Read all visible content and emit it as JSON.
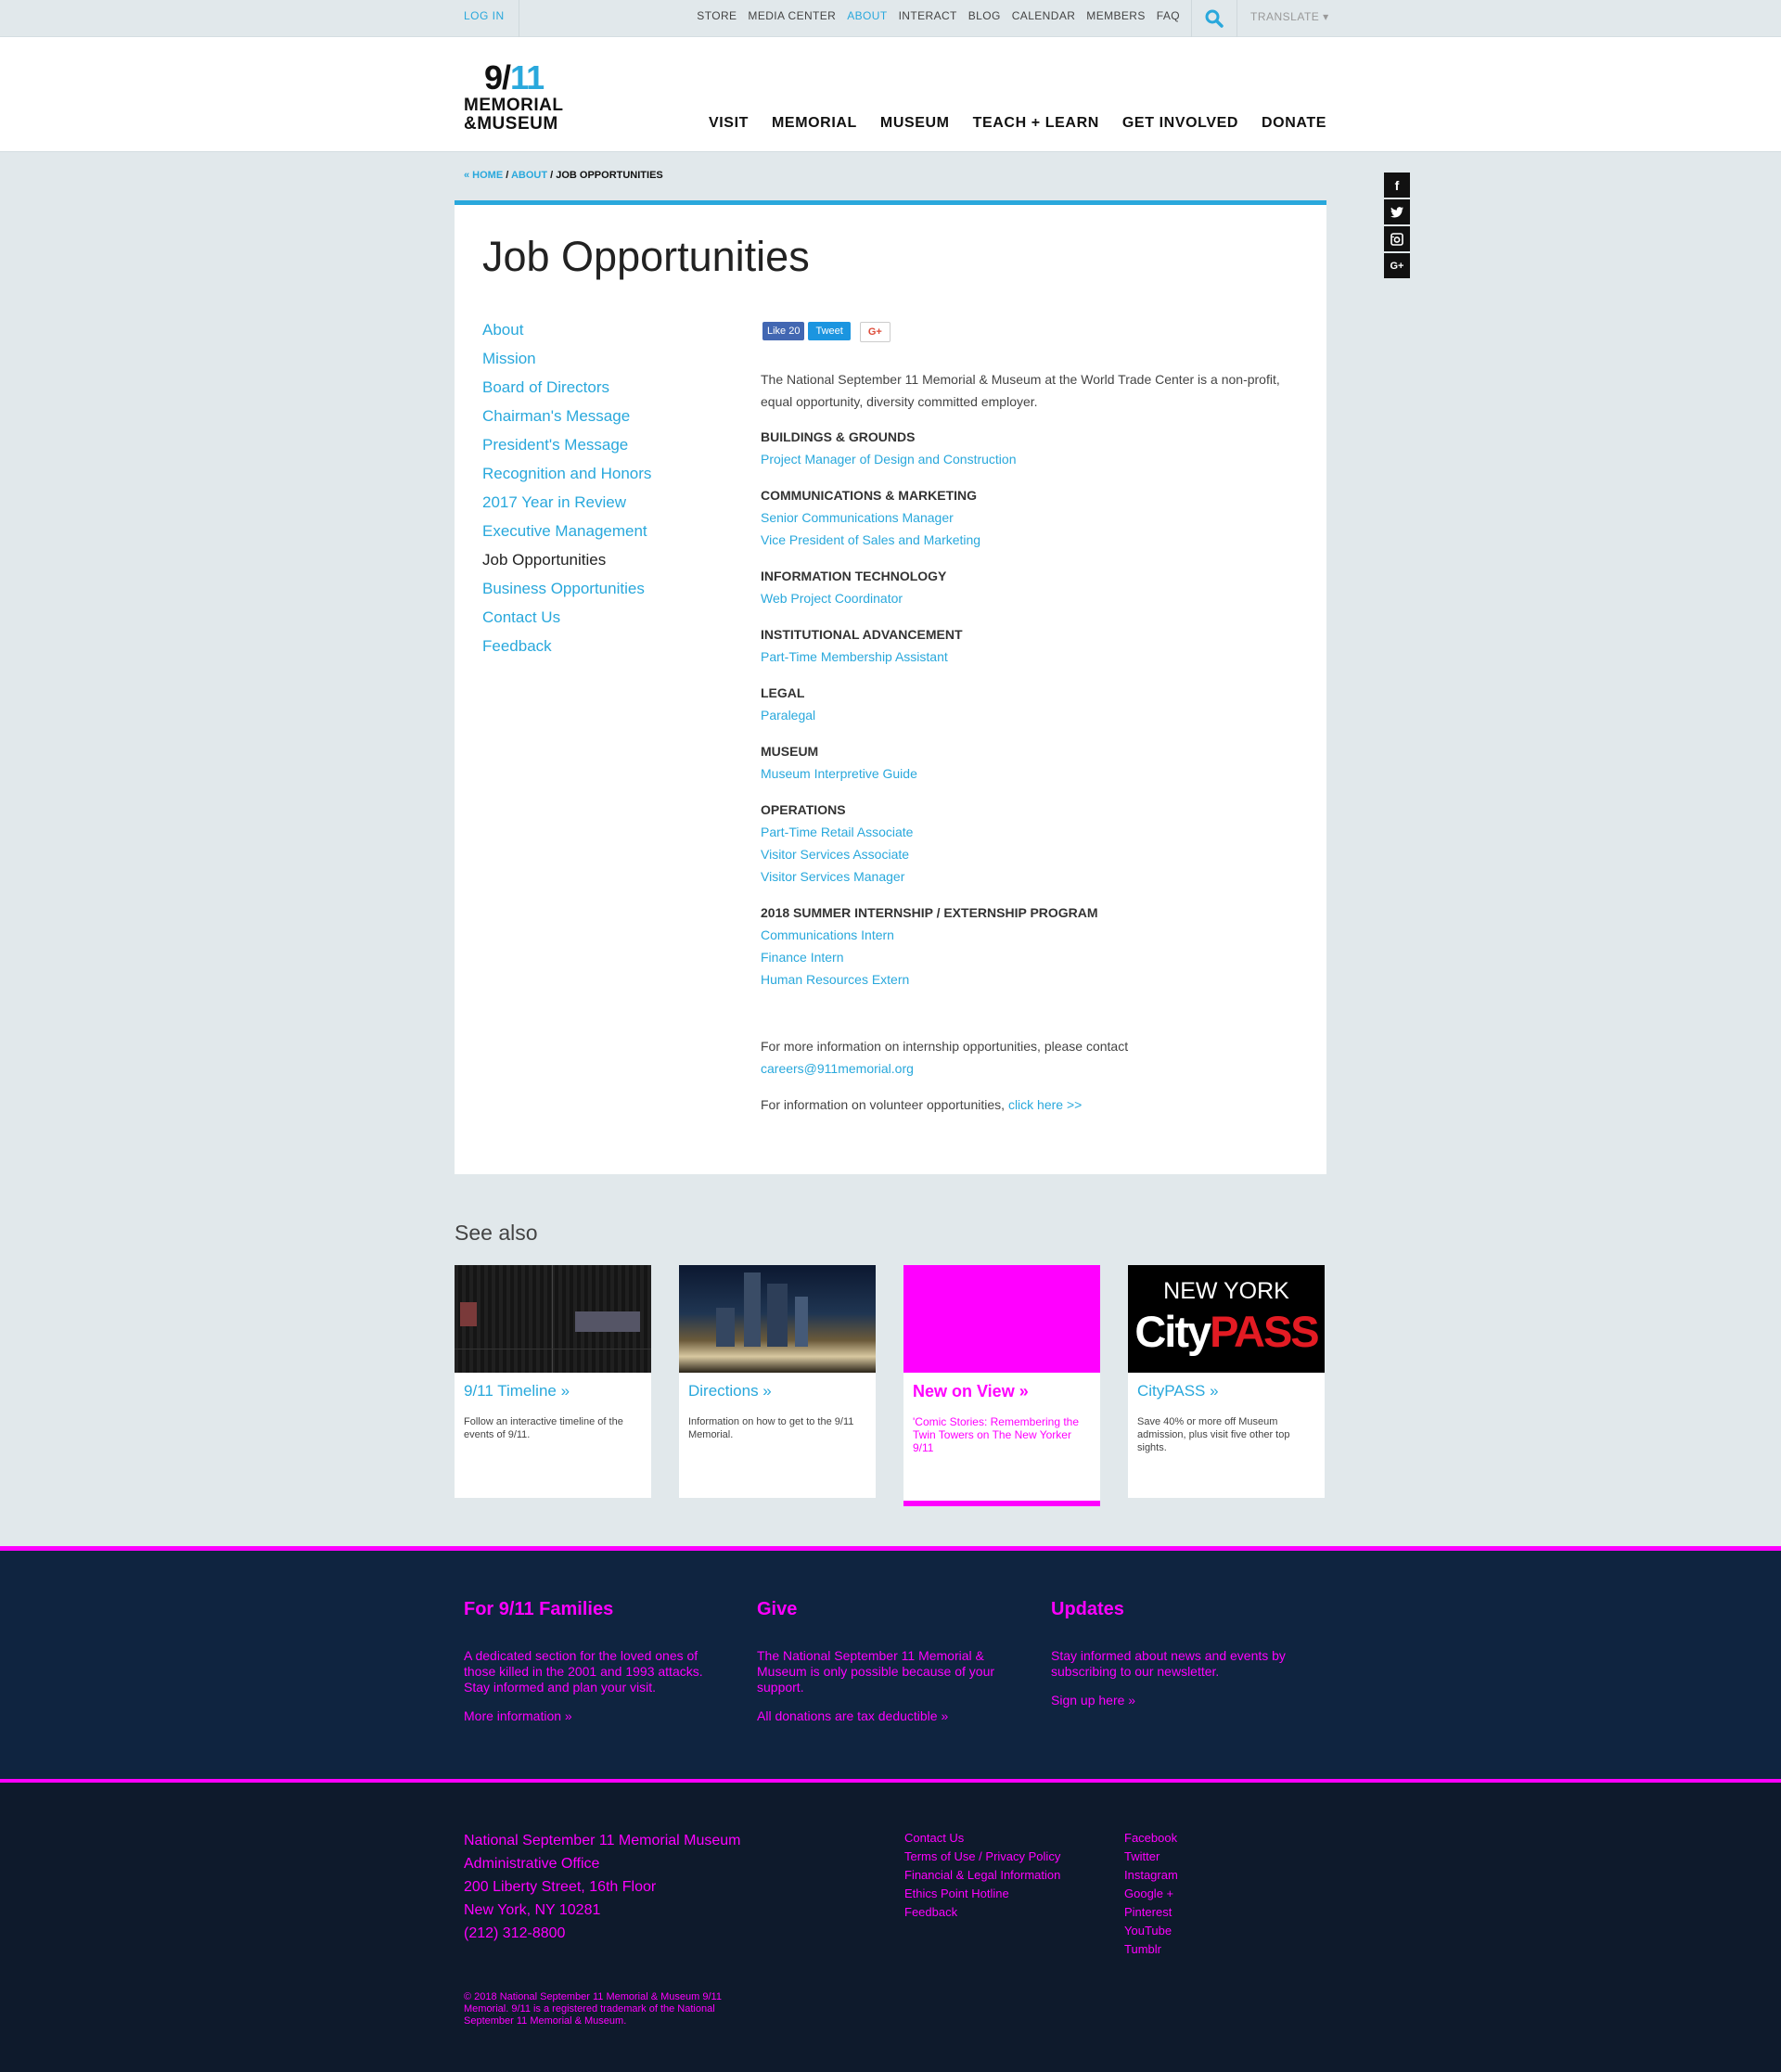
{
  "utility": {
    "login": "LOG IN",
    "links": [
      "STORE",
      "MEDIA CENTER",
      "ABOUT",
      "INTERACT",
      "BLOG",
      "CALENDAR",
      "MEMBERS",
      "FAQ"
    ],
    "translate": "TRANSLATE ▾"
  },
  "logo": {
    "top": "9/11",
    "line1": "MEMORIAL",
    "line2": "&MUSEUM"
  },
  "mainnav": [
    "VISIT",
    "MEMORIAL",
    "MUSEUM",
    "TEACH + LEARN",
    "GET INVOLVED",
    "DONATE"
  ],
  "breadcrumb": {
    "home": "« HOME",
    "about": "ABOUT",
    "current": "JOB OPPORTUNITIES"
  },
  "social": [
    "f",
    "t",
    "i",
    "G+"
  ],
  "page_title": "Job Opportunities",
  "sidenav": [
    "About",
    "Mission",
    "Board of Directors",
    "Chairman's Message",
    "President's Message",
    "Recognition and Honors",
    "2017 Year in Review",
    "Executive Management",
    "Job Opportunities",
    "Business Opportunities",
    "Contact Us",
    "Feedback"
  ],
  "sidenav_current": "Job Opportunities",
  "share": {
    "like": "Like 20",
    "tweet": "Tweet",
    "gplus": "G+"
  },
  "intro": "The National September 11 Memorial & Museum at the World Trade Center is a non-profit, equal opportunity, diversity committed employer.",
  "categories": [
    {
      "name": "BUILDINGS & GROUNDS",
      "jobs": [
        "Project Manager of Design and Construction"
      ]
    },
    {
      "name": "COMMUNICATIONS & MARKETING",
      "jobs": [
        "Senior Communications Manager",
        "Vice President of Sales and Marketing"
      ]
    },
    {
      "name": "INFORMATION TECHNOLOGY",
      "jobs": [
        "Web Project Coordinator"
      ]
    },
    {
      "name": "INSTITUTIONAL ADVANCEMENT",
      "jobs": [
        "Part-Time Membership Assistant"
      ]
    },
    {
      "name": "LEGAL",
      "jobs": [
        "Paralegal"
      ]
    },
    {
      "name": "MUSEUM",
      "jobs": [
        "Museum Interpretive Guide"
      ]
    },
    {
      "name": "OPERATIONS",
      "jobs": [
        "Part-Time Retail Associate",
        "Visitor Services Associate",
        "Visitor Services Manager"
      ]
    },
    {
      "name": "2018 SUMMER INTERNSHIP / EXTERNSHIP PROGRAM",
      "jobs": [
        "Communications Intern",
        "Finance Intern",
        "Human Resources Extern"
      ]
    }
  ],
  "more_info": {
    "text": "For more information on internship opportunities, please contact ",
    "email": "careers@911memorial.org"
  },
  "volunteer": {
    "text": "For information on volunteer opportunities, ",
    "link": "click here >>"
  },
  "see_also": {
    "title": "See also",
    "tiles": [
      {
        "title": "9/11 Timeline »",
        "desc": "Follow an interactive timeline of the events of 9/11."
      },
      {
        "title": "Directions »",
        "desc": "Information on how to get to the 9/11 Memorial."
      },
      {
        "title": "New on View »",
        "desc": "'Comic Stories: Remembering the Twin Towers on The New Yorker 9/11"
      },
      {
        "title": "CityPASS »",
        "desc": "Save 40% or more off Museum admission, plus visit five other top sights.",
        "img_top": "NEW YORK",
        "img_city": "City",
        "img_pass": "PASS"
      }
    ]
  },
  "footer_cols": [
    {
      "heading": "For 9/11 Families",
      "text": "A dedicated section for the loved ones of those killed in the 2001 and 1993 attacks. Stay informed and plan your visit.",
      "link": "More information »"
    },
    {
      "heading": "Give",
      "text": "The National September 11 Memorial & Museum is only possible because of your support.",
      "link": "All donations are tax deductible »"
    },
    {
      "heading": "Updates",
      "text": "Stay informed about news and events by subscribing to our newsletter.",
      "link": "Sign up here »"
    }
  ],
  "address": [
    "National September 11 Memorial Museum",
    "Administrative Office",
    "200 Liberty Street, 16th Floor",
    "New York, NY 10281",
    "(212) 312-8800"
  ],
  "footer_links1": [
    "Contact Us",
    "Terms of Use / Privacy Policy",
    "Financial & Legal Information",
    "Ethics Point Hotline",
    "Feedback"
  ],
  "footer_links2": [
    "Facebook",
    "Twitter",
    "Instagram",
    "Google +",
    "Pinterest",
    "YouTube",
    "Tumblr"
  ],
  "copyright": "© 2018 National September 11 Memorial & Museum 9/11 Memorial. 9/11 is a registered trademark of the National September 11 Memorial & Museum.",
  "colors": {
    "accent": "#29a8dc",
    "placeholder": "#ff00ff",
    "footer_bg": "#0f2440"
  }
}
